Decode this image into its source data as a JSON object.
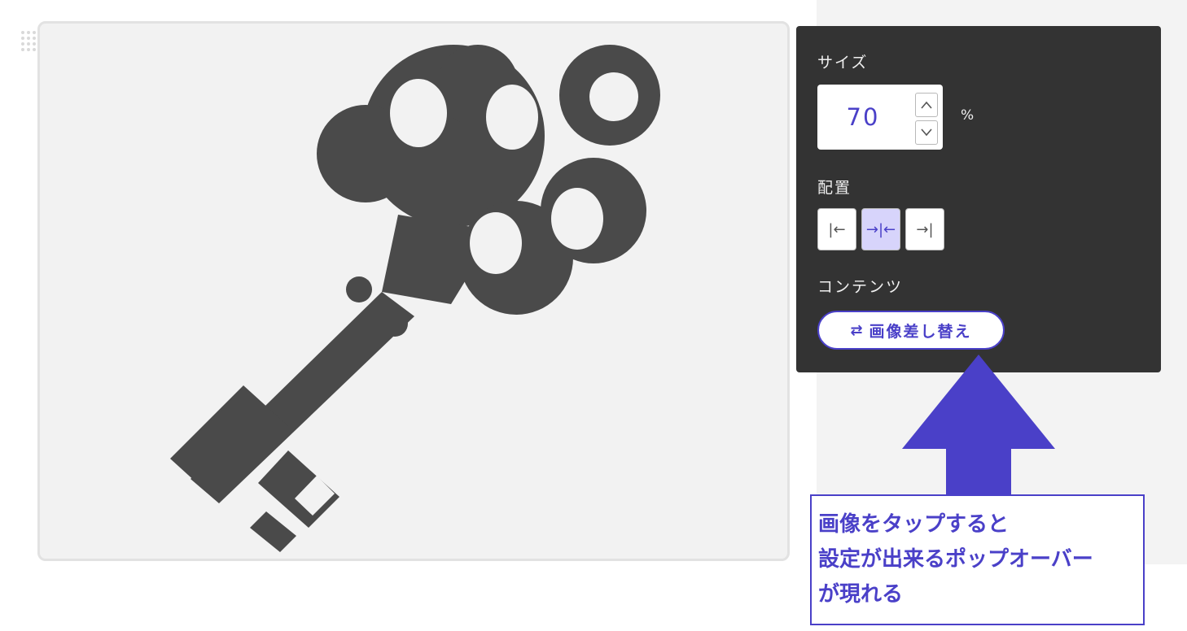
{
  "editor": {
    "drag_handle_icon": "grip-dots-icon",
    "image_description_icon": "key-icon",
    "image_color": "#4a4a4a"
  },
  "popover": {
    "size_label": "サイズ",
    "size_value": "70",
    "size_unit": "%",
    "alignment_label": "配置",
    "alignment": {
      "options": [
        {
          "name": "align-left",
          "glyph": "|←",
          "active": false
        },
        {
          "name": "align-center",
          "glyph": "→|←",
          "active": true
        },
        {
          "name": "align-right",
          "glyph": "→|",
          "active": false
        }
      ]
    },
    "content_label": "コンテンツ",
    "replace_button": {
      "icon": "⇄",
      "label": "画像差し替え"
    }
  },
  "annotation": {
    "lines": [
      "画像をタップすると",
      "設定が出来るポップオーバー",
      "が現れる"
    ],
    "accent_color": "#4a40c8"
  }
}
